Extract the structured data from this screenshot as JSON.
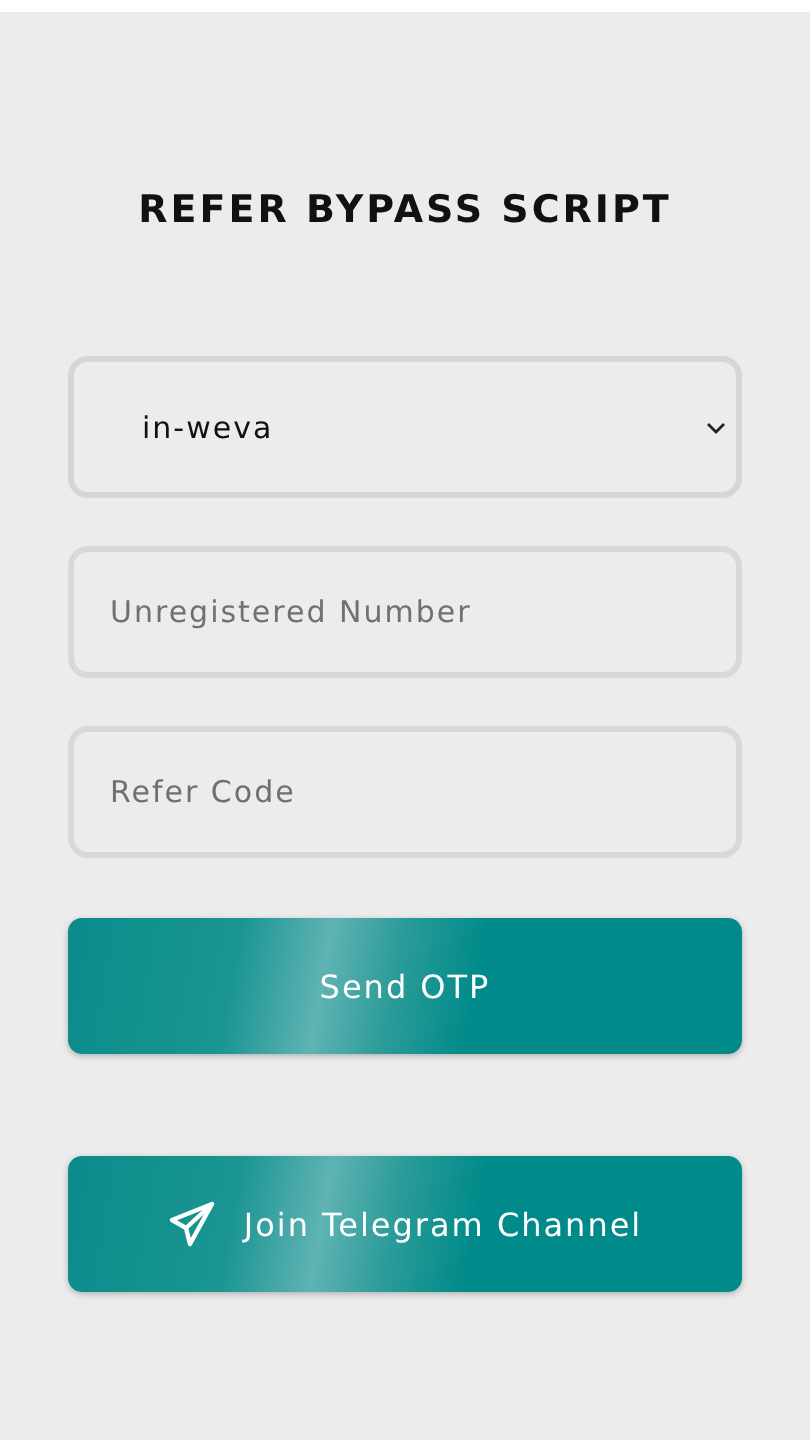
{
  "title": "REFER BYPASS SCRIPT",
  "dropdown": {
    "value": "in-weva"
  },
  "fields": [
    {
      "placeholder": "Unregistered Number"
    },
    {
      "placeholder": "Refer Code"
    }
  ],
  "buttons": [
    {
      "label": "Send OTP",
      "kind": "plain"
    },
    {
      "label": "Join Telegram Channel",
      "kind": "telegram"
    }
  ]
}
